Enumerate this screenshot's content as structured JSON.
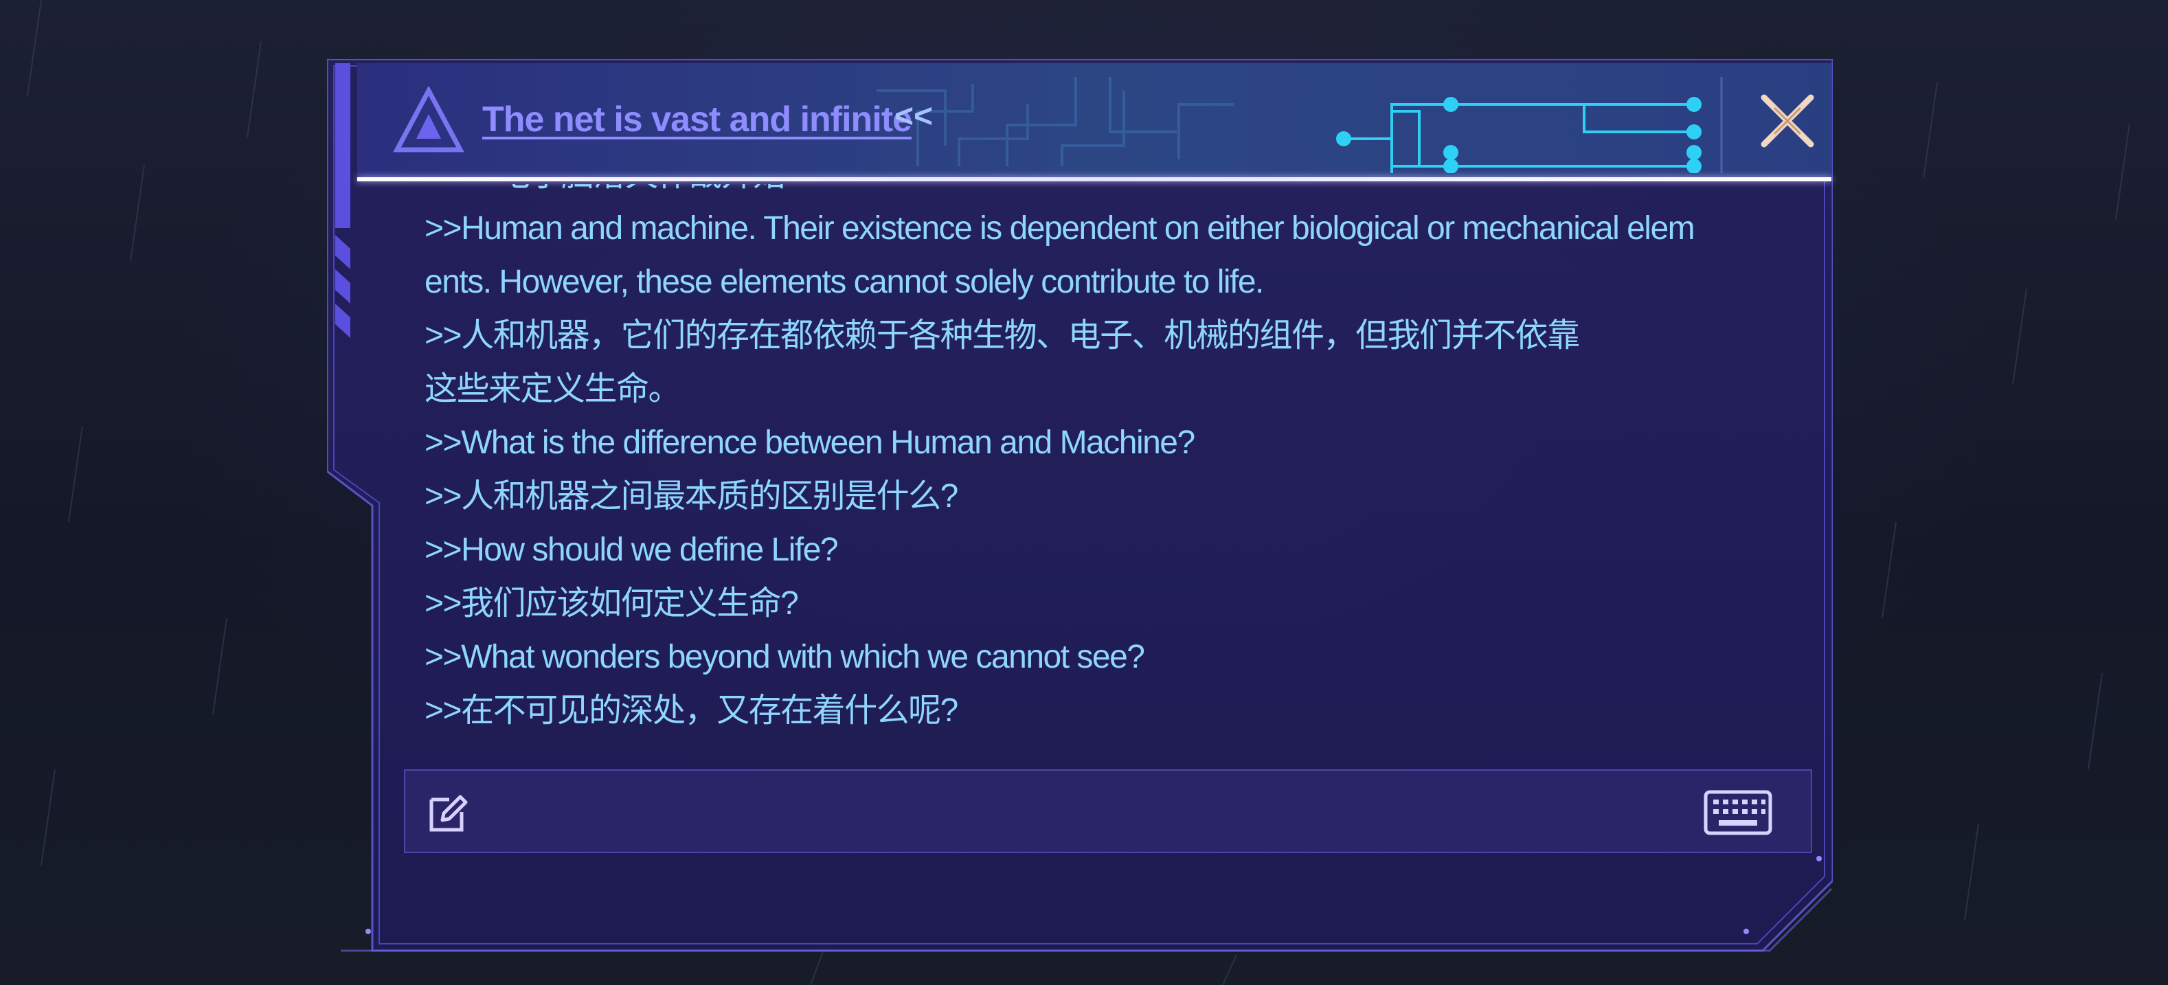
{
  "header": {
    "title": "The net is vast and infinite",
    "title_suffix": "<<",
    "warning_icon": "warning-triangle-icon",
    "close_icon": "close-icon"
  },
  "log": {
    "lines": [
      ">>>>电子脑溶天作战开始<<<<",
      ">>Human and machine. Their existence is dependent on either biological or mechanical elem",
      "ents. However, these elements cannot solely contribute to life.",
      ">>人和机器，它们的存在都依赖于各种生物、电子、机械的组件，但我们并不依靠",
      "这些来定义生命。",
      ">>What is the difference between Human and Machine?",
      ">>人和机器之间最本质的区别是什么?",
      ">>How should we define Life?",
      ">>我们应该如何定义生命?",
      ">>What wonders beyond with which we cannot see?",
      ">>在不可见的深处，又存在着什么呢?"
    ]
  },
  "input": {
    "value": "",
    "placeholder": "",
    "edit_icon": "edit-icon",
    "keyboard_icon": "keyboard-icon"
  },
  "colors": {
    "panel_bg": "#221e5a",
    "panel_border": "#5c57d6",
    "header_bg": "#2c3f7a",
    "title": "#8f8cff",
    "log_text": "#8fd6ff",
    "circuit": "#2fd0f5",
    "close": "#f2d8c0"
  }
}
